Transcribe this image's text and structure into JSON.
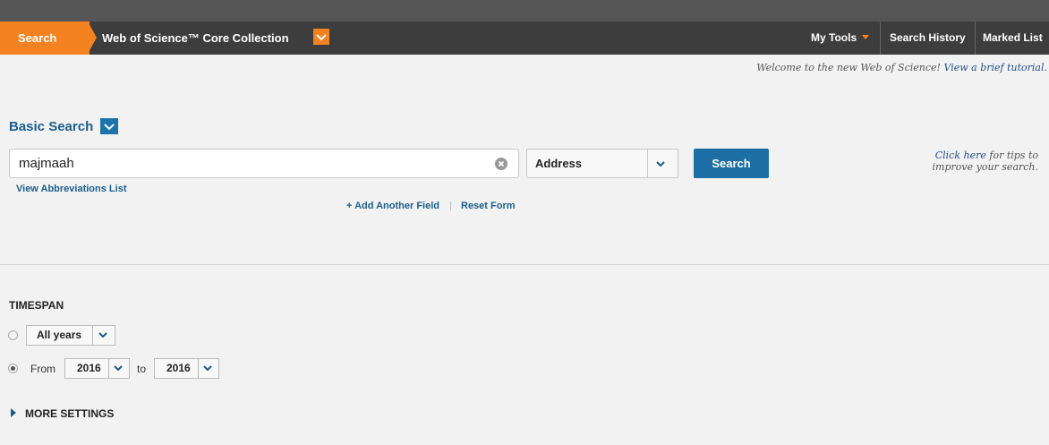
{
  "nav": {
    "search_tab": "Search",
    "collection": "Web of Science™ Core Collection",
    "my_tools": "My Tools",
    "search_history": "Search History",
    "marked_list": "Marked List",
    "accent": "#f58220"
  },
  "welcome": {
    "text": "Welcome to the new Web of Science!",
    "link": "View a brief tutorial."
  },
  "basic_search": {
    "title": "Basic Search",
    "query_value": "majmaah",
    "field_value": "Address",
    "search_button": "Search",
    "abbrev_link": "View Abbreviations List",
    "add_field": "+ Add Another Field",
    "separator": "|",
    "reset_form": "Reset Form"
  },
  "tips": {
    "link": "Click here",
    "text": "for tips to improve your search."
  },
  "timespan": {
    "title": "TIMESPAN",
    "all_years": "All years",
    "from_label": "From",
    "from_year": "2016",
    "to_label": "to",
    "to_year": "2016",
    "selected_option": "from-to"
  },
  "more_settings": "MORE SETTINGS",
  "icons": {
    "collection_dropdown": "chevron-down-icon",
    "basic_search_dropdown": "chevron-down-icon",
    "clear": "clear-icon",
    "expand": "triangle-right-icon"
  }
}
